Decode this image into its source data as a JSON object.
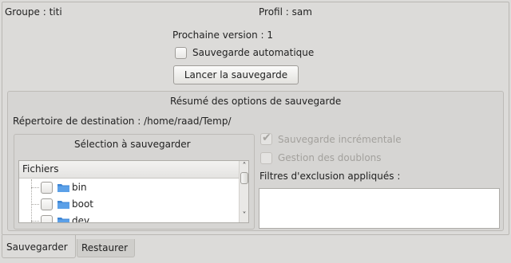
{
  "header": {
    "group_label": "Groupe : titi",
    "profile_label": "Profil : sam"
  },
  "backup": {
    "next_version_label": "Prochaine version : 1",
    "auto_backup_label": "Sauvegarde automatique",
    "auto_backup_checked": false,
    "run_button_label": "Lancer la sauvegarde"
  },
  "options": {
    "title": "Résumé des options de sauvegarde",
    "destination_label": "Répertoire de destination : /home/raad/Temp/",
    "selection": {
      "title": "Sélection à sauvegarder",
      "column_header": "Fichiers",
      "items": [
        {
          "name": "bin",
          "checked": false
        },
        {
          "name": "boot",
          "checked": false
        },
        {
          "name": "dev",
          "checked": false
        }
      ]
    },
    "incremental_label": "Sauvegarde incrémentale",
    "incremental_checked": true,
    "duplicates_label": "Gestion des doublons",
    "duplicates_checked": false,
    "exclusion_filters_label": "Filtres d'exclusion appliqués :",
    "exclusion_filters": []
  },
  "tabs": [
    {
      "label": "Sauvegarder",
      "active": true
    },
    {
      "label": "Restaurer",
      "active": false
    }
  ],
  "colors": {
    "window_bg": "#dcdbd9",
    "folder_icon": "#4a90d9",
    "disabled_text": "#a3a19d"
  }
}
